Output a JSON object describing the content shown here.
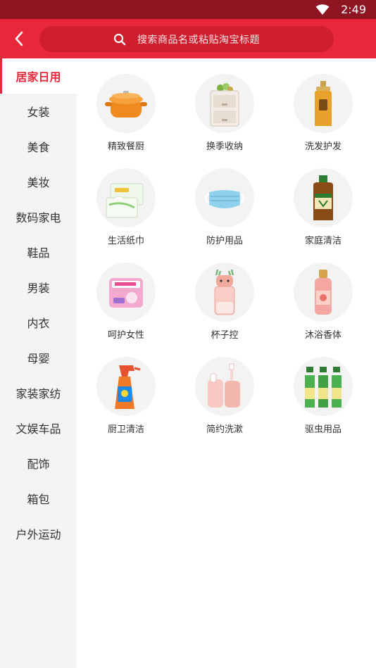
{
  "status_bar": {
    "time": "2:49"
  },
  "search": {
    "placeholder": "搜索商品名或粘贴淘宝标题"
  },
  "sidebar": {
    "items": [
      {
        "label": "居家日用"
      },
      {
        "label": "女装"
      },
      {
        "label": "美食"
      },
      {
        "label": "美妆"
      },
      {
        "label": "数码家电"
      },
      {
        "label": "鞋品"
      },
      {
        "label": "男装"
      },
      {
        "label": "内衣"
      },
      {
        "label": "母婴"
      },
      {
        "label": "家装家纺"
      },
      {
        "label": "文娱车品"
      },
      {
        "label": "配饰"
      },
      {
        "label": "箱包"
      },
      {
        "label": "户外运动"
      }
    ]
  },
  "categories": [
    {
      "label": "精致餐厨",
      "icon": "cooking-pot-icon"
    },
    {
      "label": "换季收纳",
      "icon": "storage-drawer-icon"
    },
    {
      "label": "洗发护发",
      "icon": "shampoo-bottle-icon"
    },
    {
      "label": "生活纸巾",
      "icon": "tissue-box-icon"
    },
    {
      "label": "防护用品",
      "icon": "face-mask-icon"
    },
    {
      "label": "家庭清洁",
      "icon": "disinfectant-bottle-icon"
    },
    {
      "label": "呵护女性",
      "icon": "sanitary-pad-icon"
    },
    {
      "label": "杯子控",
      "icon": "water-cup-icon"
    },
    {
      "label": "沐浴香体",
      "icon": "body-mist-icon"
    },
    {
      "label": "厨卫清洁",
      "icon": "spray-cleaner-icon"
    },
    {
      "label": "简约洗漱",
      "icon": "toothbrush-cup-icon"
    },
    {
      "label": "驱虫用品",
      "icon": "insect-repellent-icon"
    }
  ],
  "colors": {
    "brand": "#e8283a",
    "status_bar": "#8e1522",
    "search_bg": "#cf1f2f"
  }
}
